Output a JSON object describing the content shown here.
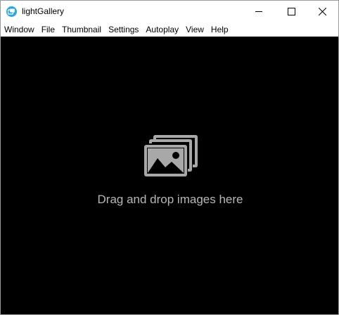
{
  "window": {
    "title": "lightGallery",
    "controls": {
      "minimize_icon": "minimize-icon",
      "maximize_icon": "maximize-icon",
      "close_icon": "close-icon"
    }
  },
  "menubar": {
    "items": [
      "Window",
      "File",
      "Thumbnail",
      "Settings",
      "Autoplay",
      "View",
      "Help"
    ]
  },
  "content": {
    "background": "#000000",
    "icon": "images-icon",
    "message": "Drag and drop images here",
    "text_color": "#b7b7b7"
  },
  "colors": {
    "accent": "#29a8e0",
    "titlebar": "#ffffff"
  }
}
